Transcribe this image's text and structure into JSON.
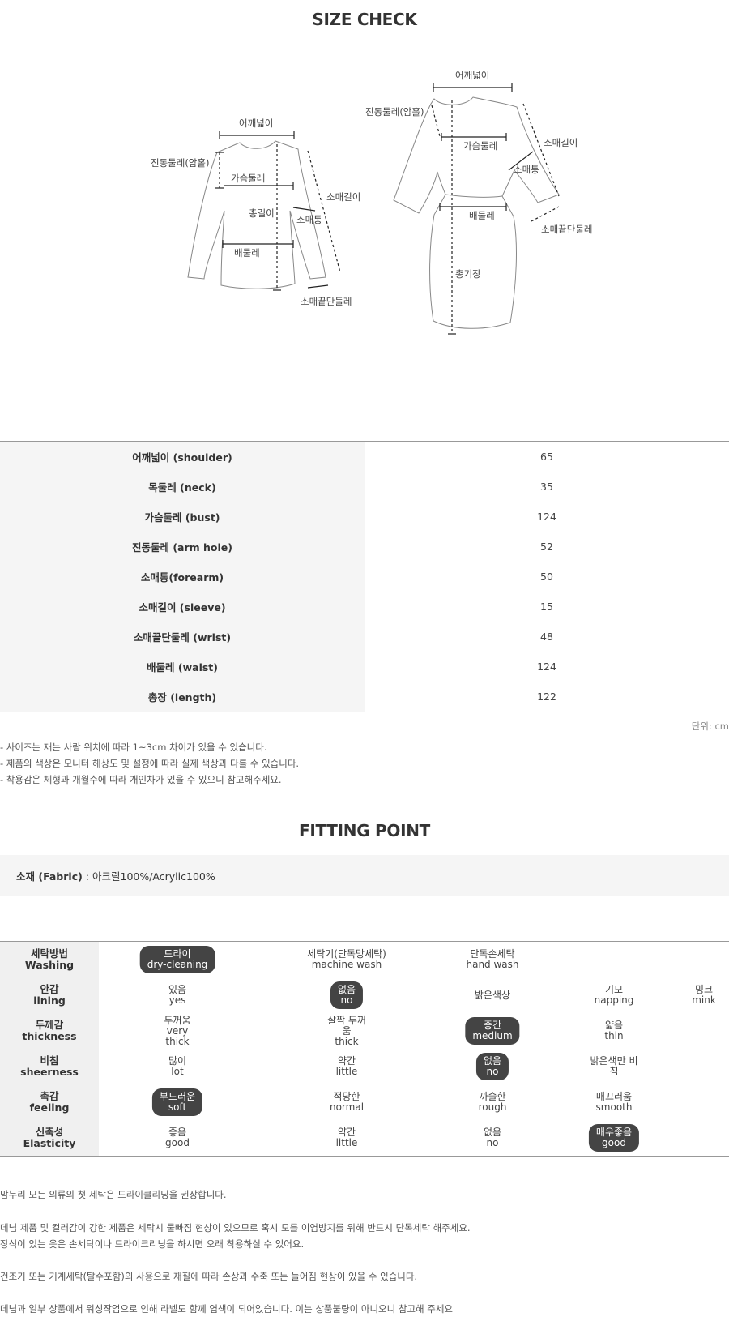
{
  "size_check": {
    "title": "SIZE CHECK",
    "top_labels": {
      "shoulder": "어깨넓이",
      "armhole": "진동둘레(암홀)",
      "bust": "가슴둘레",
      "length": "총길이",
      "forearm": "소매통",
      "sleeve": "소매길이",
      "waist": "배둘레",
      "wrist": "소매끝단둘레"
    },
    "dress_labels": {
      "shoulder": "어깨넓이",
      "armhole": "진동둘레(암홀)",
      "bust": "가슴둘레",
      "sleeve": "소매길이",
      "forearm": "소매통",
      "waist": "배둘레",
      "wrist": "소매끝단둘레",
      "length": "총기장"
    },
    "rows": [
      {
        "label": "어깨넓이 (shoulder)",
        "value": "65"
      },
      {
        "label": "목둘레 (neck)",
        "value": "35"
      },
      {
        "label": "가슴둘레 (bust)",
        "value": "124"
      },
      {
        "label": "진동둘레 (arm hole)",
        "value": "52"
      },
      {
        "label": "소매통(forearm)",
        "value": "50"
      },
      {
        "label": "소매길이 (sleeve)",
        "value": "15"
      },
      {
        "label": "소매끝단둘레 (wrist)",
        "value": "48"
      },
      {
        "label": "배둘레 (waist)",
        "value": "124"
      },
      {
        "label": "총장 (length)",
        "value": "122"
      }
    ],
    "unit": "단위: cm",
    "notes": [
      "- 사이즈는 재는 사람 위치에 따라 1~3cm 차이가 있을 수 있습니다.",
      "- 제품의 색상은 모니터 해상도 및 설정에 따라 실제 색상과 다를 수 있습니다.",
      "- 착용감은 체형과 개월수에 따라 개인차가 있을 수 있으니 참고해주세요."
    ]
  },
  "fitting_point": {
    "title": "FITTING POINT",
    "fabric_label": "소재 (Fabric)",
    "fabric_value": " : 아크릴100%/Acrylic100%",
    "rows": [
      {
        "ko": "세탁방법",
        "en": "Washing",
        "options": [
          {
            "text": "드라이\ndry-cleaning",
            "selected": true
          },
          {
            "text": "세탁기(단독망세탁)\nmachine wash",
            "selected": false
          },
          {
            "text": "단독손세탁\nhand wash",
            "selected": false
          },
          {
            "text": "",
            "selected": false
          },
          {
            "text": "",
            "selected": false
          }
        ]
      },
      {
        "ko": "안감",
        "en": "lining",
        "options": [
          {
            "text": "있음\nyes",
            "selected": false
          },
          {
            "text": "없음\nno",
            "selected": true
          },
          {
            "text": "밝은색상",
            "selected": false
          },
          {
            "text": "기모\nnapping",
            "selected": false
          },
          {
            "text": "밍크\nmink",
            "selected": false
          }
        ]
      },
      {
        "ko": "두께감",
        "en": "thickness",
        "options": [
          {
            "text": "두꺼움\nvery\nthick",
            "selected": false
          },
          {
            "text": "살짝 두꺼\n움\nthick",
            "selected": false
          },
          {
            "text": "중간\nmedium",
            "selected": true
          },
          {
            "text": "얇음\nthin",
            "selected": false
          },
          {
            "text": "",
            "selected": false
          }
        ]
      },
      {
        "ko": "비침",
        "en": "sheerness",
        "options": [
          {
            "text": "많이\nlot",
            "selected": false
          },
          {
            "text": "약간\nlittle",
            "selected": false
          },
          {
            "text": "없음\nno",
            "selected": true
          },
          {
            "text": "밝은색만 비\n침",
            "selected": false
          },
          {
            "text": "",
            "selected": false
          }
        ]
      },
      {
        "ko": "촉감",
        "en": "feeling",
        "options": [
          {
            "text": "부드러운\nsoft",
            "selected": true
          },
          {
            "text": "적당한\nnormal",
            "selected": false
          },
          {
            "text": "까슬한\nrough",
            "selected": false
          },
          {
            "text": "매끄러움\nsmooth",
            "selected": false
          },
          {
            "text": "",
            "selected": false
          }
        ]
      },
      {
        "ko": "신축성",
        "en": "Elasticity",
        "options": [
          {
            "text": "좋음\ngood",
            "selected": false
          },
          {
            "text": "약간\nlittle",
            "selected": false
          },
          {
            "text": "없음\nno",
            "selected": false
          },
          {
            "text": "매우좋음\ngood",
            "selected": true
          },
          {
            "text": "",
            "selected": false
          }
        ]
      }
    ],
    "footer": [
      "맘누리 모든 의류의 첫 세탁은 드라이클리닝을 권장합니다.",
      "데님 제품 및 컬러감이 강한 제품은 세탁시 물빠짐 현상이 있으므로 혹시 모를 이염방지를 위해 반드시 단독세탁 해주세요.",
      "장식이 있는 옷은 손세탁이나 드라이크리닝을 하시면 오래 착용하실 수 있어요.",
      "건조기 또는 기계세탁(탈수포함)의 사용으로 재질에 따라 손상과 수축 또는 늘어짐 현상이 있을 수 있습니다.",
      "데님과 일부 상품에서 워싱작업으로 인해 라벨도 함께 염색이 되어있습니다. 이는 상품불량이 아니오니 참고해 주세요"
    ]
  }
}
